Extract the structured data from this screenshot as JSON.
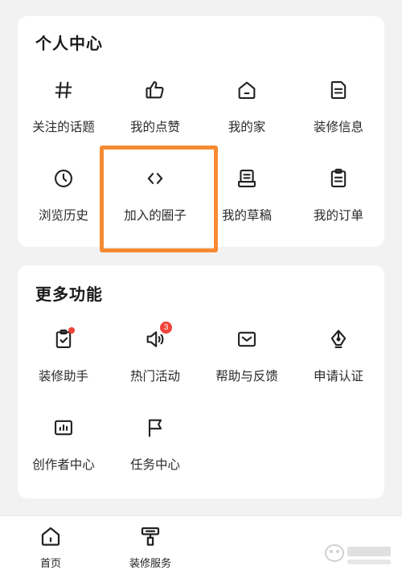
{
  "personal_center": {
    "title": "个人中心",
    "items": [
      {
        "label": "关注的话题",
        "icon": "hashtag-icon"
      },
      {
        "label": "我的点赞",
        "icon": "thumbs-up-icon"
      },
      {
        "label": "我的家",
        "icon": "home-icon"
      },
      {
        "label": "装修信息",
        "icon": "document-icon"
      },
      {
        "label": "浏览历史",
        "icon": "clock-icon"
      },
      {
        "label": "加入的圈子",
        "icon": "code-brackets-icon"
      },
      {
        "label": "我的草稿",
        "icon": "draft-icon"
      },
      {
        "label": "我的订单",
        "icon": "clipboard-icon"
      }
    ]
  },
  "more_features": {
    "title": "更多功能",
    "items": [
      {
        "label": "装修助手",
        "icon": "checklist-icon",
        "has_dot": true
      },
      {
        "label": "热门活动",
        "icon": "speaker-icon",
        "badge": "3"
      },
      {
        "label": "帮助与反馈",
        "icon": "mail-icon"
      },
      {
        "label": "申请认证",
        "icon": "pen-nib-icon"
      },
      {
        "label": "创作者中心",
        "icon": "bar-chart-icon"
      },
      {
        "label": "任务中心",
        "icon": "flag-icon"
      }
    ]
  },
  "tabbar": {
    "home_label": "首页",
    "service_label": "装修服务"
  },
  "colors": {
    "highlight": "#f68a33",
    "badge": "#f0433a",
    "background": "#f2f2f2"
  }
}
